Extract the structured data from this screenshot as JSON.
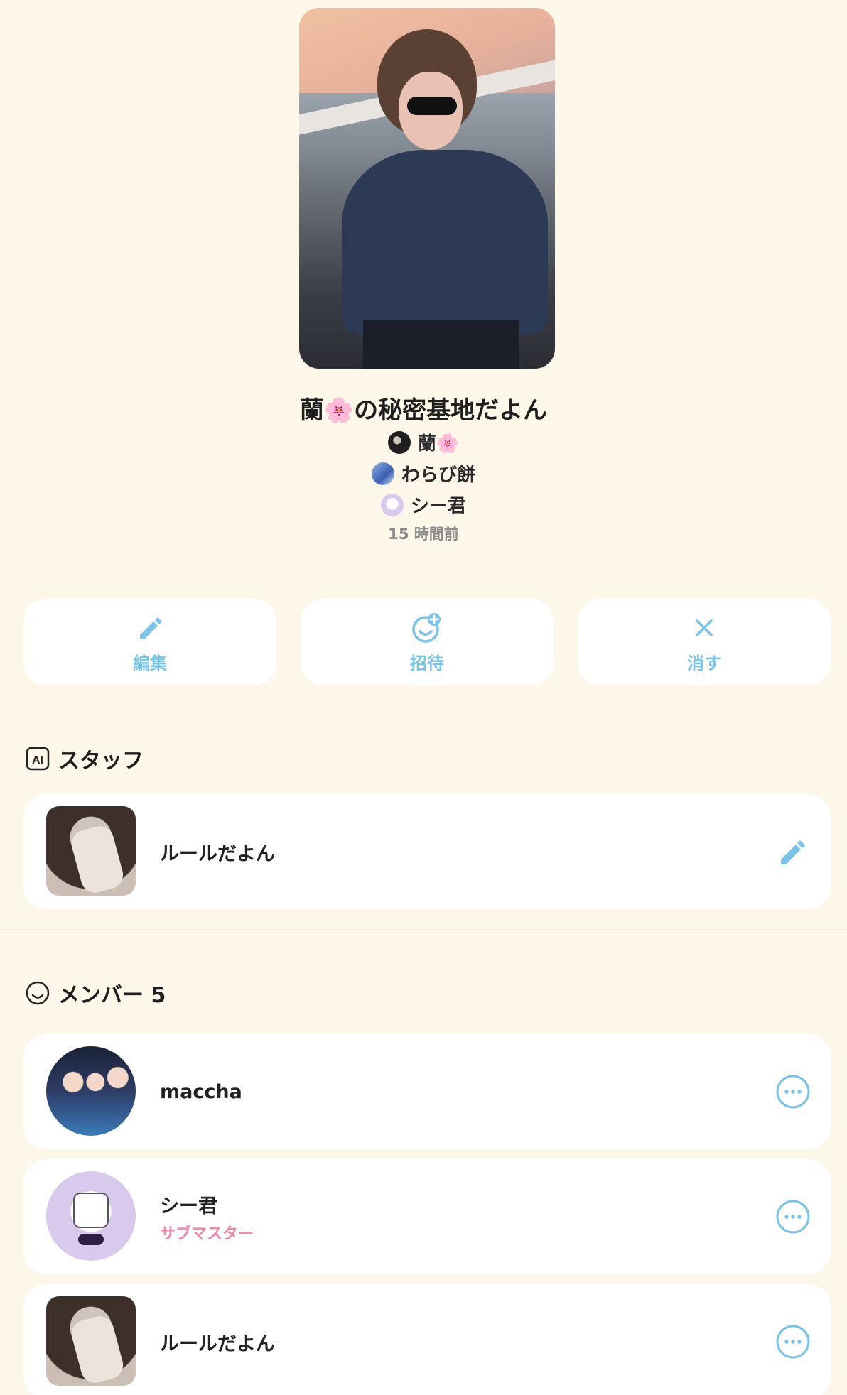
{
  "room": {
    "title_prefix": "蘭",
    "title_flower": "🌸",
    "title_suffix": "の秘密基地だよん",
    "members_preview": [
      {
        "name": "蘭🌸",
        "avatar": "dark-photo"
      },
      {
        "name": "わらび餅",
        "avatar": "blue-photo"
      },
      {
        "name": "シー君",
        "avatar": "cartoon"
      }
    ],
    "updated": "15 時間前"
  },
  "actions": [
    {
      "label": "編集",
      "icon": "pencil-icon"
    },
    {
      "label": "招待",
      "icon": "invite-icon"
    },
    {
      "label": "消す",
      "icon": "close-icon"
    }
  ],
  "staff": {
    "heading": "スタッフ",
    "icon": "ai-icon",
    "items": [
      {
        "name": "ルールだよん",
        "action_icon": "pencil-icon"
      }
    ]
  },
  "members": {
    "heading": "メンバー 5",
    "icon": "smile-icon",
    "items": [
      {
        "name": "maccha",
        "role": ""
      },
      {
        "name": "シー君",
        "role": "サブマスター"
      },
      {
        "name": "ルールだよん",
        "role": ""
      }
    ]
  },
  "colors": {
    "background": "#fdf7ea",
    "accent": "#79c3e8",
    "role": "#ef88a8"
  }
}
